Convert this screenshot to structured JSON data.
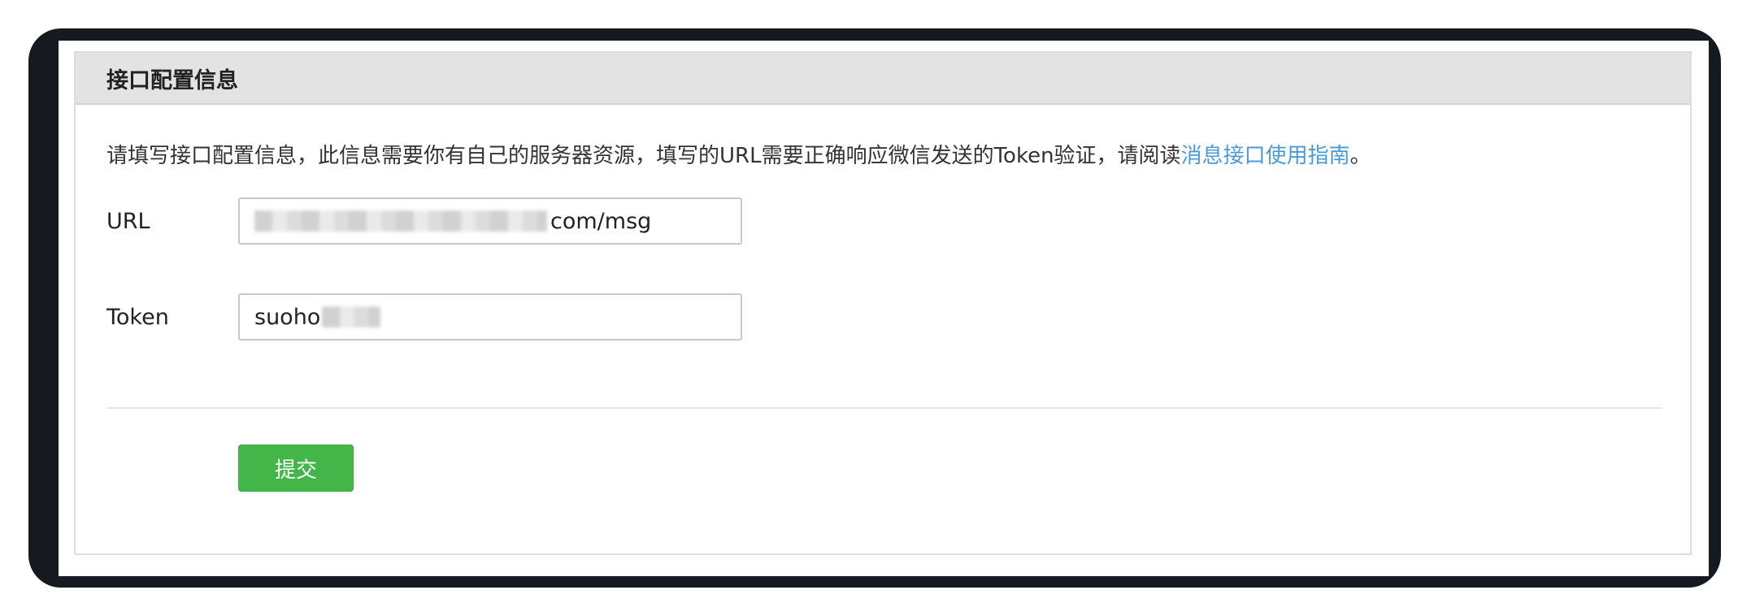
{
  "panel": {
    "title": "接口配置信息"
  },
  "description": {
    "text": "请填写接口配置信息，此信息需要你有自己的服务器资源，填写的URL需要正确响应微信发送的Token验证，请阅读",
    "link_text": "消息接口使用指南",
    "suffix": "。"
  },
  "form": {
    "url": {
      "label": "URL",
      "value_visible_suffix": "com/msg"
    },
    "token": {
      "label": "Token",
      "value_visible_prefix": "suoho"
    },
    "submit_label": "提交"
  },
  "colors": {
    "accent_green": "#44b549",
    "link_blue": "#4a9ad8",
    "header_bg": "#e3e3e3",
    "frame_dark": "#16191f"
  }
}
